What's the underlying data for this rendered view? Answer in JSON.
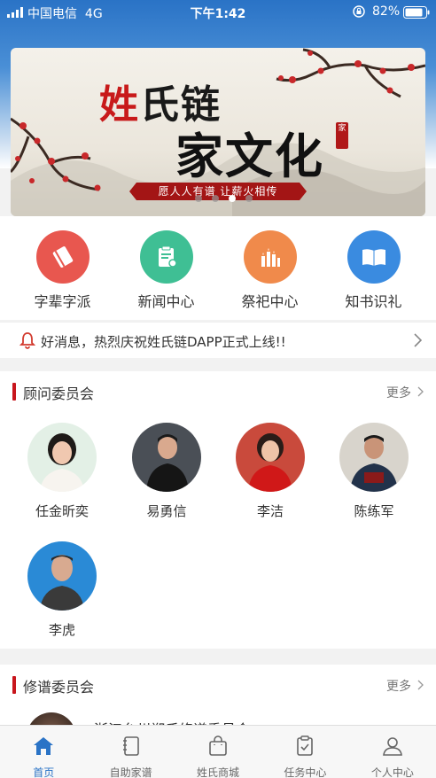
{
  "status_bar": {
    "carrier": "中国电信",
    "network": "4G",
    "time": "下午1:42",
    "battery": "82%"
  },
  "banner": {
    "title_red": "姓",
    "title_rest": "氏链",
    "subtitle": "家文化",
    "seal": "家",
    "slogan": "愿人人有谱  让薪火相传",
    "active_slide": 2,
    "slide_count": 4
  },
  "quick_nav": [
    {
      "label": "字辈字派",
      "icon": "book-red-icon",
      "color": "#e8574f"
    },
    {
      "label": "新闻中心",
      "icon": "news-clipboard-icon",
      "color": "#3fbf94"
    },
    {
      "label": "祭祀中心",
      "icon": "candles-icon",
      "color": "#f08a4b"
    },
    {
      "label": "知书识礼",
      "icon": "open-book-icon",
      "color": "#3a8be0"
    }
  ],
  "notice": {
    "text": "好消息，热烈庆祝姓氏链DAPP正式上线!!"
  },
  "advisory": {
    "title": "顾问委员会",
    "more": "更多",
    "members": [
      {
        "name": "任金昕奕"
      },
      {
        "name": "易勇信"
      },
      {
        "name": "李洁"
      },
      {
        "name": "陈练军"
      },
      {
        "name": "李虎"
      }
    ]
  },
  "genealogy": {
    "title": "修谱委员会",
    "more": "更多",
    "item_title": "浙江台州郑氏修谱委员会"
  },
  "tab_bar": [
    {
      "label": "首页",
      "icon": "home-icon",
      "active": true
    },
    {
      "label": "自助家谱",
      "icon": "notebook-icon",
      "active": false
    },
    {
      "label": "姓氏商城",
      "icon": "shopping-bag-icon",
      "active": false
    },
    {
      "label": "任务中心",
      "icon": "task-clipboard-icon",
      "active": false
    },
    {
      "label": "个人中心",
      "icon": "person-icon",
      "active": false
    }
  ],
  "colors": {
    "accent": "#2a73c6",
    "section_bar": "#c8161d"
  }
}
